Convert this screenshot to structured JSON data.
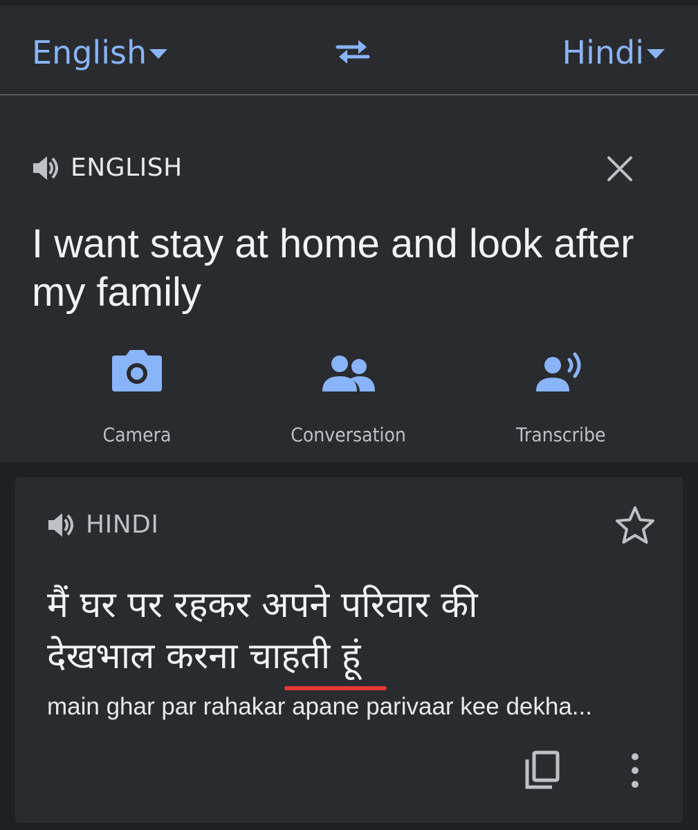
{
  "header": {
    "source_language": "English",
    "target_language": "Hindi",
    "icons": {
      "source_dropdown": "chevron-down-icon",
      "swap": "swap-languages-icon",
      "target_dropdown": "chevron-down-icon"
    }
  },
  "input": {
    "language_label": "ENGLISH",
    "text": "I want stay at home and look after my family",
    "icons": {
      "speaker": "speaker-icon",
      "clear": "close-icon"
    }
  },
  "tools": [
    {
      "label": "Camera",
      "icon": "camera-icon"
    },
    {
      "label": "Conversation",
      "icon": "people-icon"
    },
    {
      "label": "Transcribe",
      "icon": "transcribe-icon"
    }
  ],
  "output": {
    "language_label": "HINDI",
    "line1": "मैं घर पर रहकर अपने परिवार की",
    "line2": "देखभाल करना चाहती हूं",
    "romanization": "main ghar par rahakar apane parivaar kee dekha...",
    "icons": {
      "speaker": "speaker-icon",
      "favorite": "star-icon",
      "copy": "copy-icon",
      "more": "more-vert-icon"
    }
  },
  "colors": {
    "accent": "#8ab4f8",
    "background": "#1f2023",
    "surface": "#2a2b2f",
    "text": "#f1f3f4",
    "secondary_text": "#bdc1c6",
    "spellcheck_underline": "#e53935"
  }
}
